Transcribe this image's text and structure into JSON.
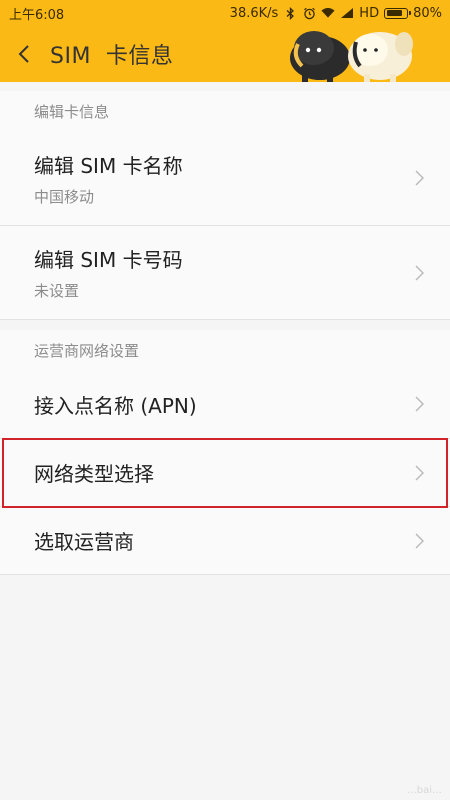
{
  "status_bar": {
    "time": "上午6:08",
    "speed": "38.6K/s",
    "network_label": "HD",
    "battery_percent": "80%",
    "battery_level": 0.8,
    "icons": [
      "bluetooth-icon",
      "alarm-icon",
      "wifi-icon",
      "signal-icon",
      "battery-icon"
    ]
  },
  "header": {
    "title": "SIM  卡信息",
    "back_icon": "chevron-left-icon",
    "background_color": "#fbb915"
  },
  "sections": [
    {
      "title": "编辑卡信息",
      "items": [
        {
          "label": "编辑 SIM 卡名称",
          "sub": "中国移动"
        },
        {
          "label": "编辑 SIM 卡号码",
          "sub": "未设置"
        }
      ]
    },
    {
      "title": "运营商网络设置",
      "items": [
        {
          "label": "接入点名称 (APN)"
        },
        {
          "label": "网络类型选择",
          "highlighted": true
        },
        {
          "label": "选取运营商"
        }
      ]
    }
  ],
  "highlight_color": "#d0232a",
  "watermark": "…bai…"
}
